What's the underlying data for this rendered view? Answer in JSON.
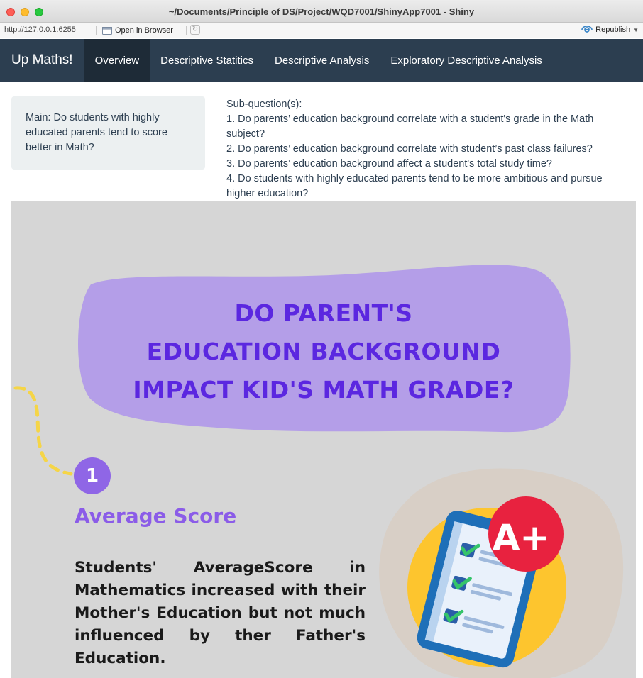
{
  "window": {
    "title": "~/Documents/Principle of DS/Project/WQD7001/ShinyApp7001 - Shiny",
    "url": "http://127.0.0.1:6255",
    "open_in_browser": "Open in Browser",
    "republish": "Republish"
  },
  "navbar": {
    "brand": "Up Maths!",
    "tabs": [
      {
        "label": "Overview",
        "active": true
      },
      {
        "label": "Descriptive Statitics",
        "active": false
      },
      {
        "label": "Descriptive Analysis",
        "active": false
      },
      {
        "label": "Exploratory Descriptive Analysis",
        "active": false
      }
    ]
  },
  "main_question": "Main: Do students with highly educated parents tend to score better in Math?",
  "sub_questions": {
    "heading": "Sub-question(s):",
    "items": [
      "1. Do parents’ education background correlate with a student's grade in the Math subject?",
      "2. Do parents’ education background correlate with student’s past class failures?",
      "3. Do parents’ education background affect a student's total study time?",
      "4. Do students with highly educated parents tend to be more ambitious and pursue higher education?"
    ]
  },
  "infographic": {
    "headline_lines": [
      "DO PARENT'S",
      "EDUCATION BACKGROUND",
      "IMPACT KID'S MATH GRADE?"
    ],
    "step_number": "1",
    "section_title": "Average Score",
    "body": "Students' AverageScore in Mathematics increased with their Mother's Education but not much influenced by ther Father's Education.",
    "grade_badge": "A+",
    "colors": {
      "background": "#d6d6d6",
      "blob": "#b49ee8",
      "headline": "#5b27e0",
      "accent": "#8b5ce8",
      "dashes": "#f5d547"
    }
  },
  "colors": {
    "navbar": "#2c3e50",
    "navbar_active": "#1e2b37",
    "panel": "#ecf0f1",
    "text": "#2c3e50"
  }
}
